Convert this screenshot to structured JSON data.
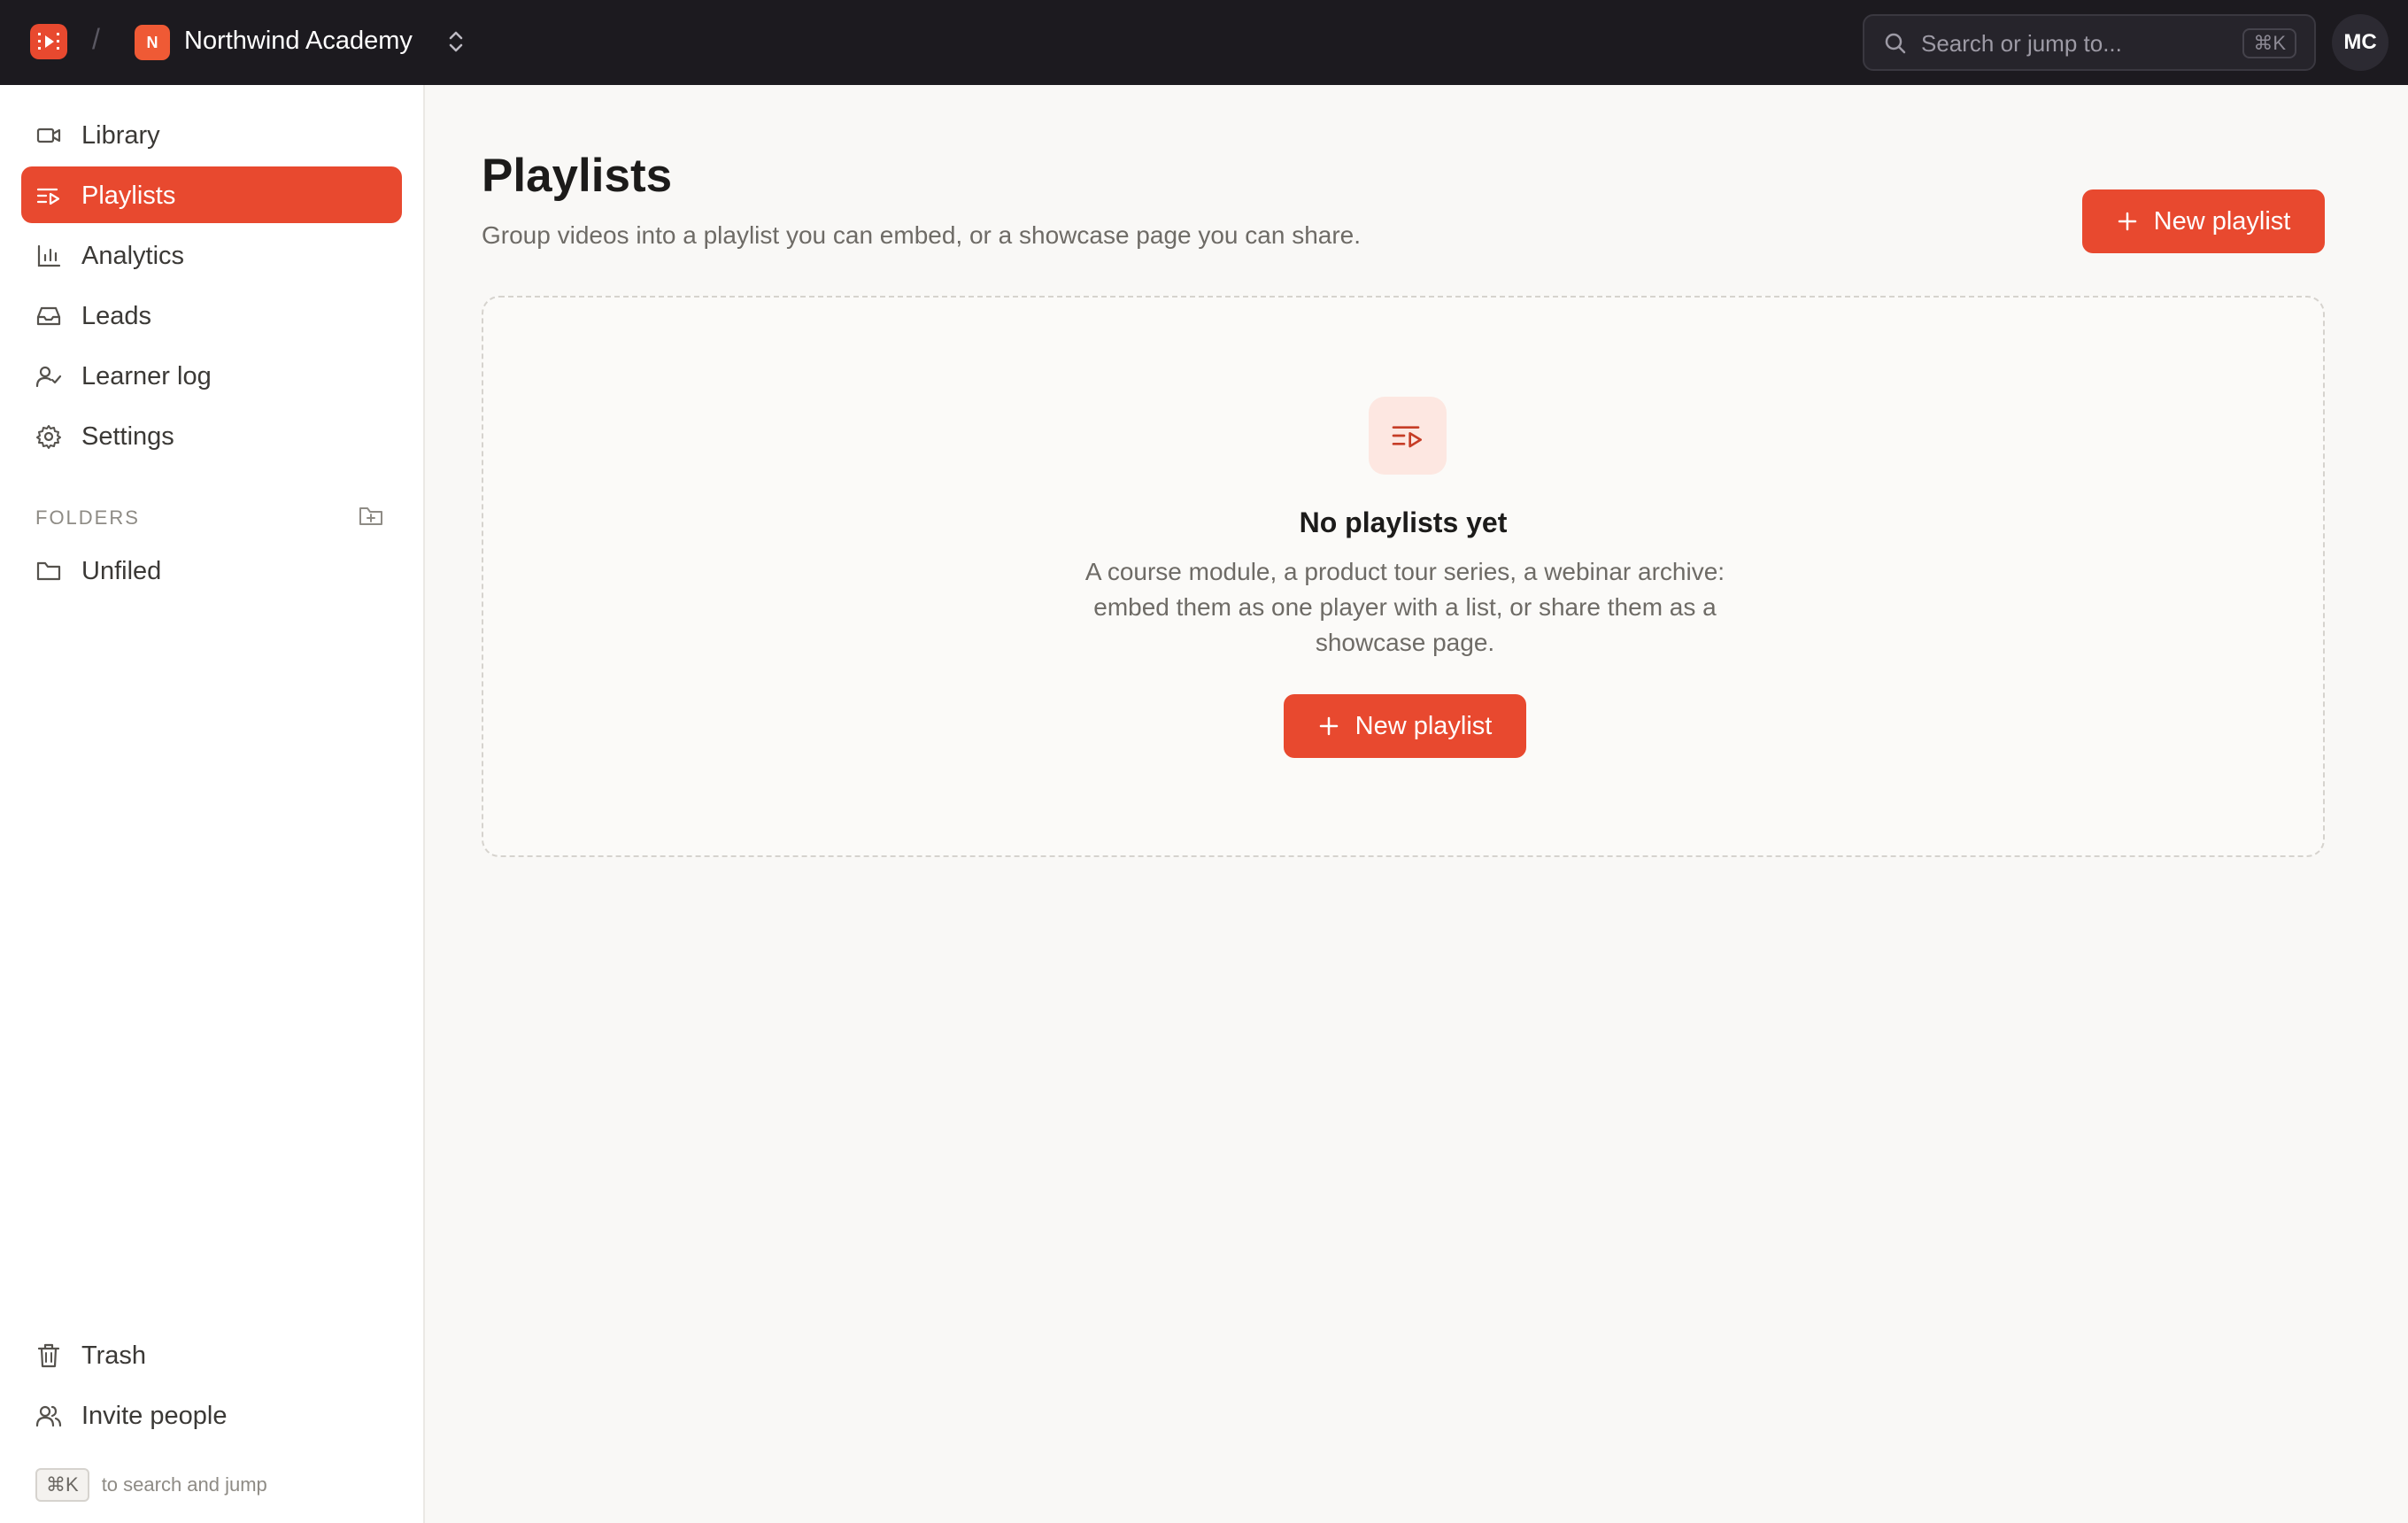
{
  "topbar": {
    "workspace_initial": "N",
    "workspace_name": "Northwind Academy",
    "separator": "/",
    "search_placeholder": "Search or jump to...",
    "search_shortcut": "⌘K",
    "avatar_initials": "MC"
  },
  "sidebar": {
    "items": [
      {
        "label": "Library",
        "icon": "video-camera-icon"
      },
      {
        "label": "Playlists",
        "icon": "playlist-icon",
        "active": true
      },
      {
        "label": "Analytics",
        "icon": "bar-chart-icon"
      },
      {
        "label": "Leads",
        "icon": "inbox-icon"
      },
      {
        "label": "Learner log",
        "icon": "user-check-icon"
      },
      {
        "label": "Settings",
        "icon": "gear-icon"
      }
    ],
    "folders_heading": "FOLDERS",
    "folders": [
      {
        "label": "Unfiled",
        "icon": "folder-icon"
      }
    ],
    "bottom_items": [
      {
        "label": "Trash",
        "icon": "trash-icon"
      },
      {
        "label": "Invite people",
        "icon": "users-icon"
      }
    ],
    "hint_kbd": "⌘K",
    "hint_text": "to search and jump"
  },
  "main": {
    "title": "Playlists",
    "subtitle": "Group videos into a playlist you can embed, or a showcase page you can share.",
    "new_button": "New playlist",
    "empty": {
      "title": "No playlists yet",
      "description": "A course module, a product tour series, a webinar archive: embed them as one player with a list, or share them as a showcase page.",
      "button": "New playlist"
    }
  },
  "colors": {
    "accent": "#e8492f",
    "topbar_bg": "#1c1a1f",
    "page_bg": "#f9f8f6"
  }
}
